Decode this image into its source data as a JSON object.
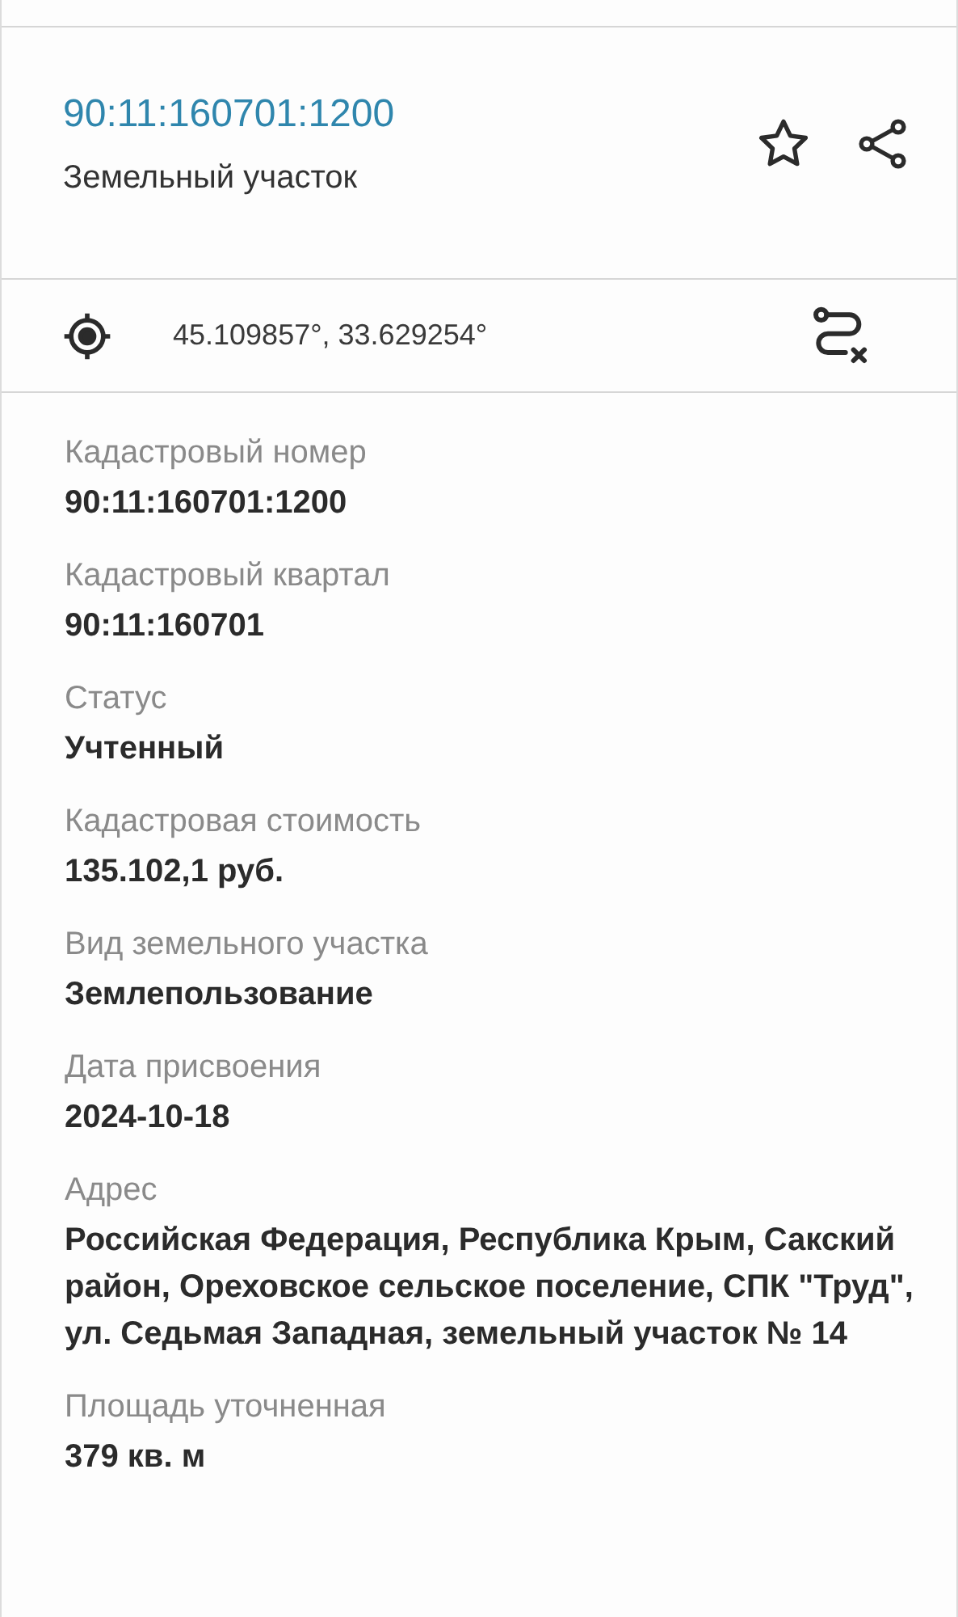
{
  "header": {
    "title": "90:11:160701:1200",
    "subtitle": "Земельный участок"
  },
  "coordinates": "45.109857°, 33.629254°",
  "fields": [
    {
      "label": "Кадастровый номер",
      "value": "90:11:160701:1200"
    },
    {
      "label": "Кадастровый квартал",
      "value": "90:11:160701"
    },
    {
      "label": "Статус",
      "value": "Учтенный"
    },
    {
      "label": "Кадастровая стоимость",
      "value": "135.102,1 руб."
    },
    {
      "label": "Вид земельного участка",
      "value": "Землепользование"
    },
    {
      "label": "Дата присвоения",
      "value": "2024-10-18"
    },
    {
      "label": "Адрес",
      "value": "Российская Федерация, Республика Крым, Сакский район, Ореховское сельское поселение, СПК \"Труд\", ул. Седьмая Западная, земельный участок № 14"
    },
    {
      "label": "Площадь уточненная",
      "value": "379 кв. м"
    }
  ]
}
